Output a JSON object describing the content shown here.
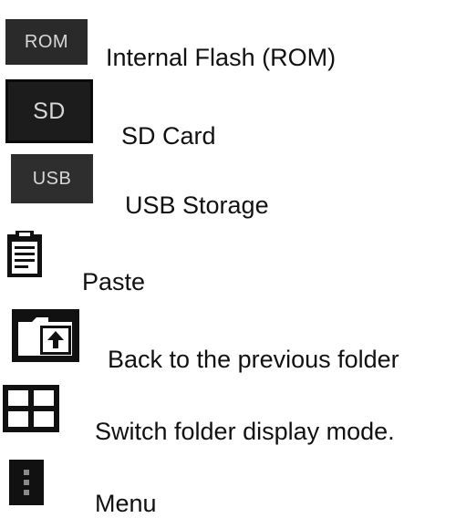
{
  "legend": {
    "items": [
      {
        "icon": "rom-icon",
        "icon_text": "ROM",
        "label": "Internal Flash (ROM)"
      },
      {
        "icon": "sd-card-icon",
        "icon_text": "SD",
        "label": "SD Card"
      },
      {
        "icon": "usb-icon",
        "icon_text": "USB",
        "label": "USB Storage"
      },
      {
        "icon": "clipboard-icon",
        "label": "Paste"
      },
      {
        "icon": "folder-up-icon",
        "label": "Back to the previous folder"
      },
      {
        "icon": "grid-icon",
        "label": "Switch folder display mode."
      },
      {
        "icon": "menu-dots-icon",
        "label": "Menu"
      }
    ]
  },
  "colors": {
    "tile_dark": "#1f1f1f",
    "tile_text": "#d8d8d8",
    "icon_black": "#111111",
    "accent_blue": "#1e6fd9"
  }
}
